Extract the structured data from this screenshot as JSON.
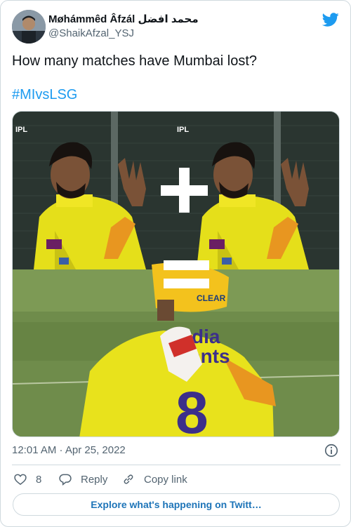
{
  "author": {
    "display_name": "Møhámmêd Âfzál محمد افضل",
    "handle": "@ShaikAfzal_YSJ"
  },
  "tweet": {
    "text": "How many matches have Mumbai lost?",
    "hashtag": "#MIvsLSG",
    "timestamp": "12:01 AM · Apr 25, 2022"
  },
  "media": {
    "watermark": "IPL",
    "helmet_text": "CLEAR",
    "jersey_number": "8",
    "jersey_text": "dia\nants",
    "operators": [
      "+",
      "="
    ]
  },
  "actions": {
    "likes_count": "8",
    "reply_label": "Reply",
    "copy_link_label": "Copy link"
  },
  "explore_label": "Explore what's happening on Twitt…",
  "colors": {
    "accent": "#1d9bf0",
    "link_button": "#1d74b8",
    "text_secondary": "#536471",
    "border": "#cfd9de"
  },
  "icons": [
    "twitter-bird-icon",
    "info-icon",
    "heart-icon",
    "reply-icon",
    "link-icon"
  ]
}
